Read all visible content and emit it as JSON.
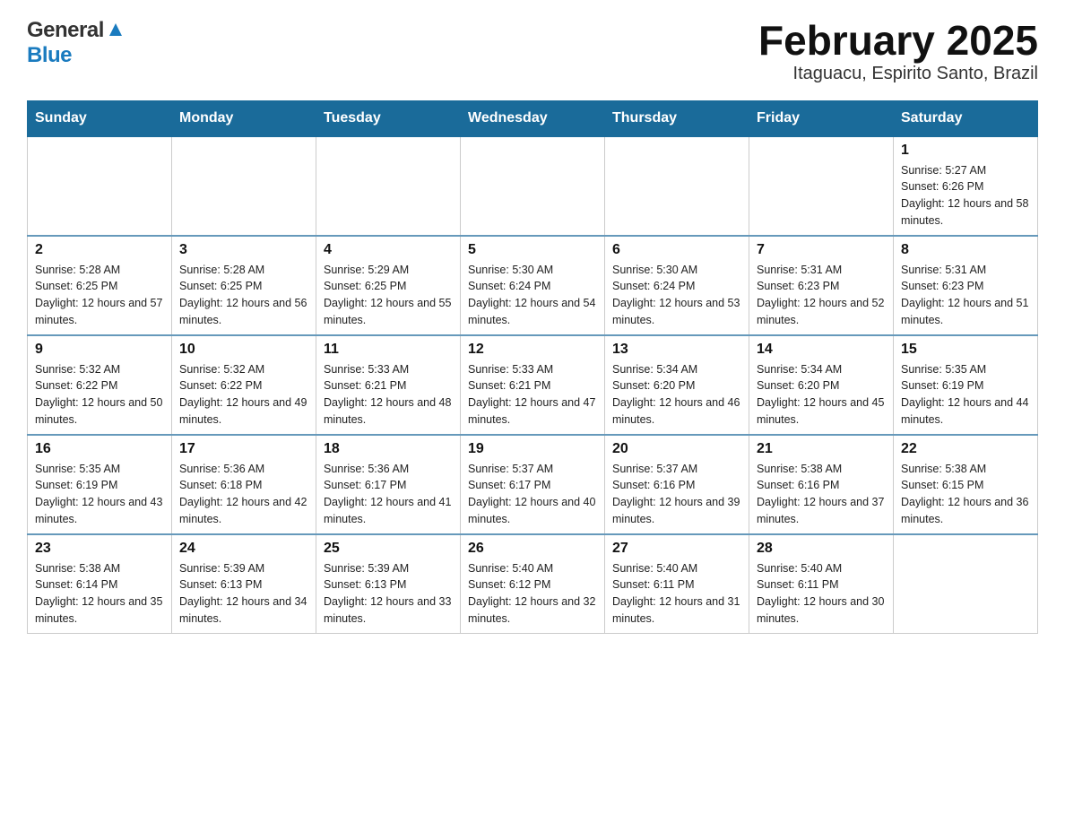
{
  "header": {
    "logo_general": "General",
    "logo_blue": "Blue",
    "title": "February 2025",
    "subtitle": "Itaguacu, Espirito Santo, Brazil"
  },
  "days_of_week": [
    "Sunday",
    "Monday",
    "Tuesday",
    "Wednesday",
    "Thursday",
    "Friday",
    "Saturday"
  ],
  "weeks": [
    [
      {
        "day": "",
        "info": ""
      },
      {
        "day": "",
        "info": ""
      },
      {
        "day": "",
        "info": ""
      },
      {
        "day": "",
        "info": ""
      },
      {
        "day": "",
        "info": ""
      },
      {
        "day": "",
        "info": ""
      },
      {
        "day": "1",
        "info": "Sunrise: 5:27 AM\nSunset: 6:26 PM\nDaylight: 12 hours and 58 minutes."
      }
    ],
    [
      {
        "day": "2",
        "info": "Sunrise: 5:28 AM\nSunset: 6:25 PM\nDaylight: 12 hours and 57 minutes."
      },
      {
        "day": "3",
        "info": "Sunrise: 5:28 AM\nSunset: 6:25 PM\nDaylight: 12 hours and 56 minutes."
      },
      {
        "day": "4",
        "info": "Sunrise: 5:29 AM\nSunset: 6:25 PM\nDaylight: 12 hours and 55 minutes."
      },
      {
        "day": "5",
        "info": "Sunrise: 5:30 AM\nSunset: 6:24 PM\nDaylight: 12 hours and 54 minutes."
      },
      {
        "day": "6",
        "info": "Sunrise: 5:30 AM\nSunset: 6:24 PM\nDaylight: 12 hours and 53 minutes."
      },
      {
        "day": "7",
        "info": "Sunrise: 5:31 AM\nSunset: 6:23 PM\nDaylight: 12 hours and 52 minutes."
      },
      {
        "day": "8",
        "info": "Sunrise: 5:31 AM\nSunset: 6:23 PM\nDaylight: 12 hours and 51 minutes."
      }
    ],
    [
      {
        "day": "9",
        "info": "Sunrise: 5:32 AM\nSunset: 6:22 PM\nDaylight: 12 hours and 50 minutes."
      },
      {
        "day": "10",
        "info": "Sunrise: 5:32 AM\nSunset: 6:22 PM\nDaylight: 12 hours and 49 minutes."
      },
      {
        "day": "11",
        "info": "Sunrise: 5:33 AM\nSunset: 6:21 PM\nDaylight: 12 hours and 48 minutes."
      },
      {
        "day": "12",
        "info": "Sunrise: 5:33 AM\nSunset: 6:21 PM\nDaylight: 12 hours and 47 minutes."
      },
      {
        "day": "13",
        "info": "Sunrise: 5:34 AM\nSunset: 6:20 PM\nDaylight: 12 hours and 46 minutes."
      },
      {
        "day": "14",
        "info": "Sunrise: 5:34 AM\nSunset: 6:20 PM\nDaylight: 12 hours and 45 minutes."
      },
      {
        "day": "15",
        "info": "Sunrise: 5:35 AM\nSunset: 6:19 PM\nDaylight: 12 hours and 44 minutes."
      }
    ],
    [
      {
        "day": "16",
        "info": "Sunrise: 5:35 AM\nSunset: 6:19 PM\nDaylight: 12 hours and 43 minutes."
      },
      {
        "day": "17",
        "info": "Sunrise: 5:36 AM\nSunset: 6:18 PM\nDaylight: 12 hours and 42 minutes."
      },
      {
        "day": "18",
        "info": "Sunrise: 5:36 AM\nSunset: 6:17 PM\nDaylight: 12 hours and 41 minutes."
      },
      {
        "day": "19",
        "info": "Sunrise: 5:37 AM\nSunset: 6:17 PM\nDaylight: 12 hours and 40 minutes."
      },
      {
        "day": "20",
        "info": "Sunrise: 5:37 AM\nSunset: 6:16 PM\nDaylight: 12 hours and 39 minutes."
      },
      {
        "day": "21",
        "info": "Sunrise: 5:38 AM\nSunset: 6:16 PM\nDaylight: 12 hours and 37 minutes."
      },
      {
        "day": "22",
        "info": "Sunrise: 5:38 AM\nSunset: 6:15 PM\nDaylight: 12 hours and 36 minutes."
      }
    ],
    [
      {
        "day": "23",
        "info": "Sunrise: 5:38 AM\nSunset: 6:14 PM\nDaylight: 12 hours and 35 minutes."
      },
      {
        "day": "24",
        "info": "Sunrise: 5:39 AM\nSunset: 6:13 PM\nDaylight: 12 hours and 34 minutes."
      },
      {
        "day": "25",
        "info": "Sunrise: 5:39 AM\nSunset: 6:13 PM\nDaylight: 12 hours and 33 minutes."
      },
      {
        "day": "26",
        "info": "Sunrise: 5:40 AM\nSunset: 6:12 PM\nDaylight: 12 hours and 32 minutes."
      },
      {
        "day": "27",
        "info": "Sunrise: 5:40 AM\nSunset: 6:11 PM\nDaylight: 12 hours and 31 minutes."
      },
      {
        "day": "28",
        "info": "Sunrise: 5:40 AM\nSunset: 6:11 PM\nDaylight: 12 hours and 30 minutes."
      },
      {
        "day": "",
        "info": ""
      }
    ]
  ]
}
